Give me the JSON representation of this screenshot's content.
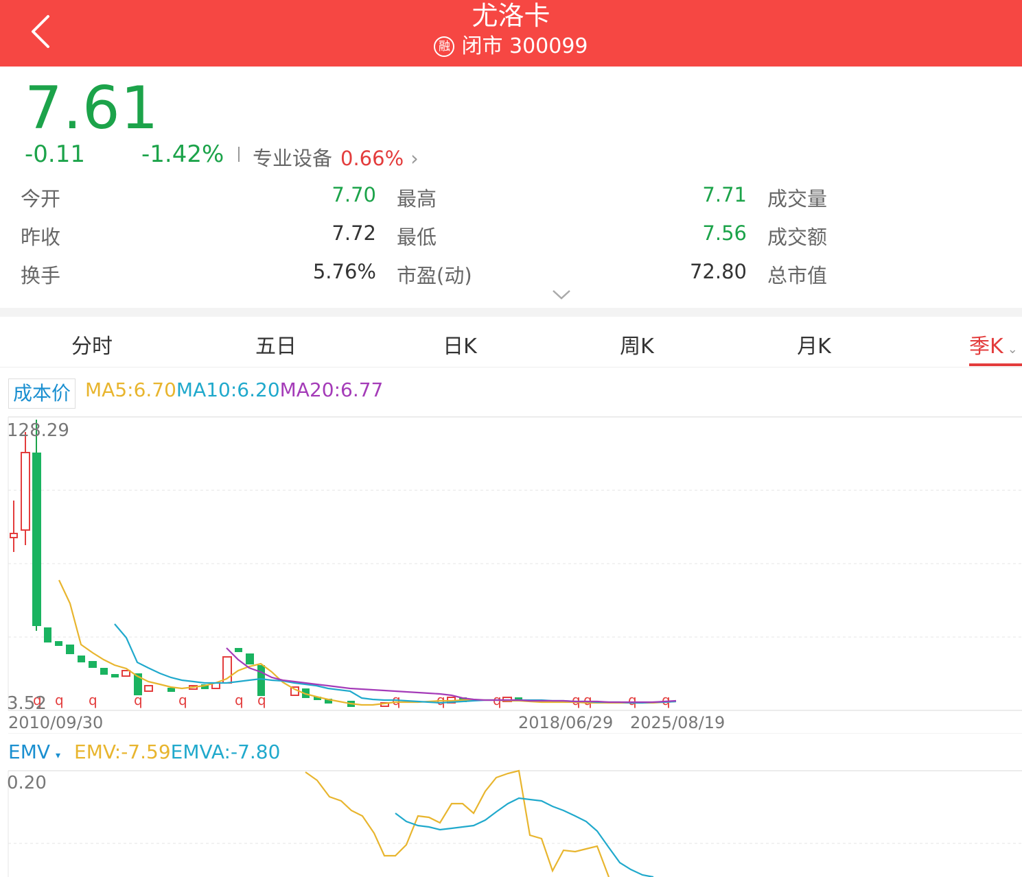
{
  "header": {
    "title": "尤洛卡",
    "margin_badge": "融",
    "status": "闭市",
    "code": "300099"
  },
  "quote": {
    "price": "7.61",
    "change": "-0.11",
    "change_pct": "-1.42%",
    "industry": "专业设备",
    "industry_pct": "0.66%"
  },
  "stats": [
    {
      "label": "今开",
      "value": "7.70",
      "color": "#1ca34a"
    },
    {
      "label": "最高",
      "value": "7.71",
      "color": "#1ca34a"
    },
    {
      "label": "成交量",
      "value": ""
    },
    {
      "label": "昨收",
      "value": "7.72",
      "color": "#333333"
    },
    {
      "label": "最低",
      "value": "7.56",
      "color": "#1ca34a"
    },
    {
      "label": "成交额",
      "value": ""
    },
    {
      "label": "换手",
      "value": "5.76%",
      "color": "#333333"
    },
    {
      "label": "市盈(动)",
      "value": "72.80",
      "color": "#333333"
    },
    {
      "label": "总市值",
      "value": ""
    }
  ],
  "tabs": [
    "分时",
    "五日",
    "日K",
    "周K",
    "月K",
    "季K"
  ],
  "active_tab": "季K",
  "kline": {
    "cost_label": "成本价",
    "ma5": "MA5:6.70",
    "ma10": "MA10:6.20",
    "ma20": "MA20:6.77",
    "y_max": "128.29",
    "y_min": "3.52",
    "x_labels": [
      "2010/09/30",
      "2018/06/29",
      "2025/08/19"
    ]
  },
  "emv": {
    "label": "EMV",
    "emv": "EMV:-7.59",
    "emva": "EMVA:-7.80",
    "y_top": "0.20"
  },
  "colors": {
    "header_bg": "#f64743",
    "up": "#e33c3c",
    "down": "#1ca34a",
    "ma5": "#e8b52e",
    "ma10": "#20a9cc",
    "ma20": "#a43bb8"
  }
}
